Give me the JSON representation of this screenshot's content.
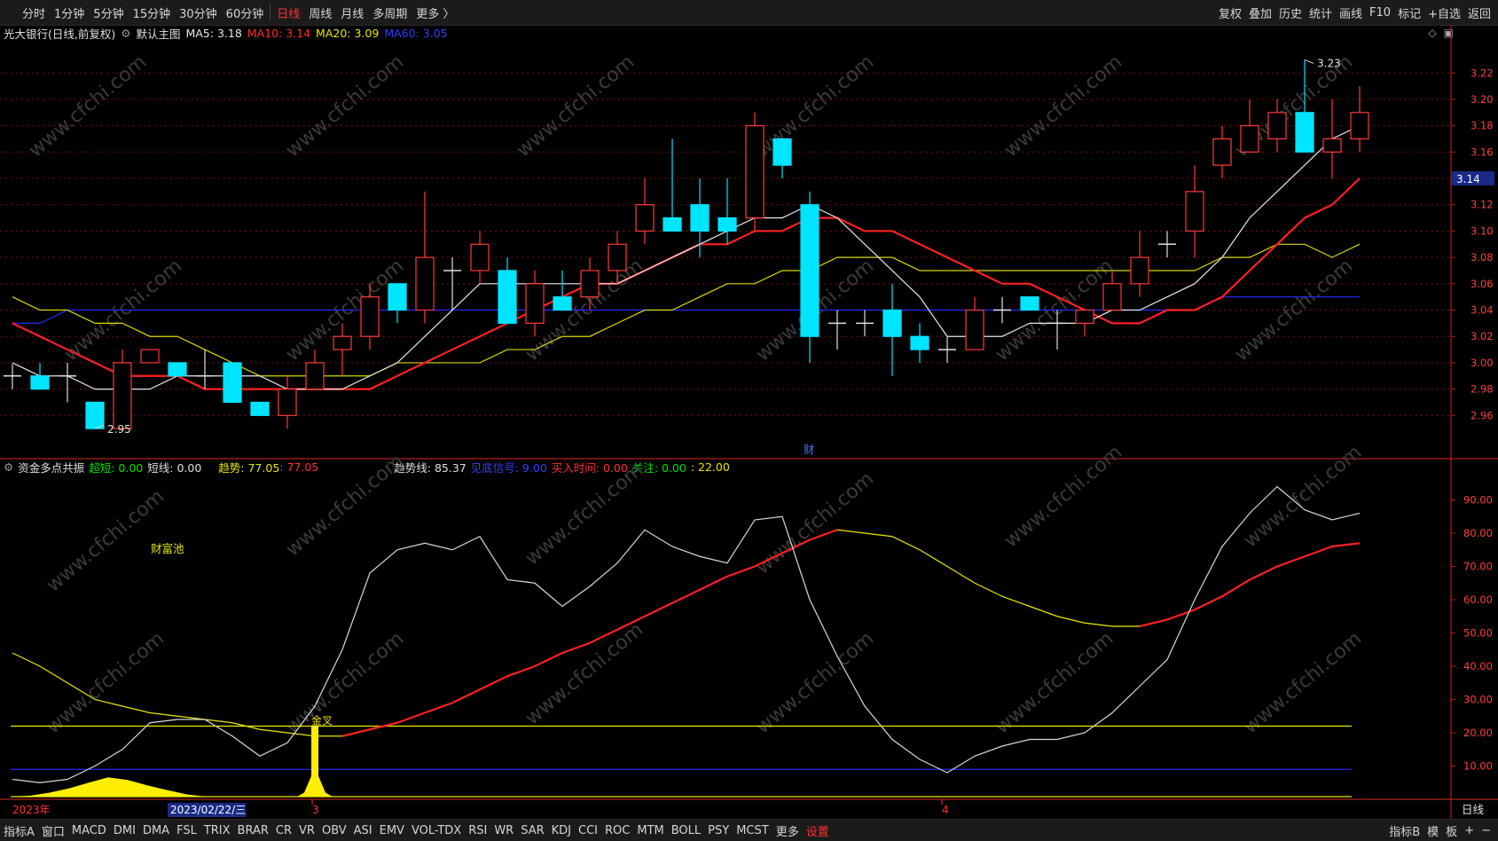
{
  "toolbar": {
    "periods": [
      "分时",
      "1分钟",
      "5分钟",
      "15分钟",
      "30分钟",
      "60分钟",
      "日线",
      "周线",
      "月线",
      "多周期",
      "更多 〉"
    ],
    "active_period": "日线",
    "right_items": [
      "复权",
      "叠加",
      "历史",
      "统计",
      "画线",
      "F10",
      "标记",
      "+自选",
      "返回"
    ]
  },
  "main_chart": {
    "title": "光大银行(日线,前复权)",
    "template": "默认主图",
    "ma5_label": "MA5: 3.18",
    "ma10_label": "MA10: 3.14",
    "ma20_label": "MA20: 3.09",
    "ma60_label": "MA60: 3.05",
    "high_label": "3.23",
    "low_label": "2.95",
    "current_price": "3.14",
    "marker_label": "财",
    "y_ticks": [
      "3.22",
      "3.20",
      "3.18",
      "3.16",
      "3.14",
      "3.12",
      "3.10",
      "3.08",
      "3.06",
      "3.04",
      "3.02",
      "3.00",
      "2.98",
      "2.96"
    ],
    "colors": {
      "up": "#ff3a3a",
      "down": "#00e5ff",
      "ma5": "#e8e8e8",
      "ma10": "#ff2020",
      "ma20": "#d8d800",
      "ma60": "#2828ff"
    }
  },
  "indicator": {
    "name": "资金多点共振",
    "chaoduan": "超短: 0.00",
    "duanxian": "短线: 0.00",
    "qushi": "趋势: 77.05",
    "qushi2": ": 77.05",
    "qushixian": "趋势线: 85.37",
    "dixin": "见底信号: 9.00",
    "mairu": "买入时间: 0.00",
    "guanzhu": "关注: 0.00",
    "extra": ": 22.00",
    "pool_label": "财富池",
    "cross_label": "金叉",
    "y_ticks": [
      "90.00",
      "80.00",
      "70.00",
      "60.00",
      "50.00",
      "40.00",
      "30.00",
      "20.00",
      "10.00"
    ]
  },
  "x_axis": {
    "labels": [
      "2023年",
      "2023/02/22/三",
      "3",
      "4"
    ],
    "right_label": "日线"
  },
  "bottombar": {
    "items": [
      "指标A",
      "窗口",
      "MACD",
      "DMI",
      "DMA",
      "FSL",
      "TRIX",
      "BRAR",
      "CR",
      "VR",
      "OBV",
      "ASI",
      "EMV",
      "VOL-TDX",
      "RSI",
      "WR",
      "SAR",
      "KDJ",
      "CCI",
      "ROC",
      "MTM",
      "BOLL",
      "PSY",
      "MCST",
      "更多",
      "设置"
    ],
    "right_items": [
      "指标B",
      "模",
      "板",
      "+",
      "−"
    ]
  },
  "watermark": "www.cfchi.com",
  "chart_data": {
    "type": "candlestick",
    "candles": [
      {
        "o": 2.99,
        "h": 2.999,
        "l": 2.98,
        "c": 2.99
      },
      {
        "o": 2.99,
        "h": 3.0,
        "l": 2.98,
        "c": 2.98
      },
      {
        "o": 2.99,
        "h": 3.0,
        "l": 2.97,
        "c": 2.99
      },
      {
        "o": 2.97,
        "h": 2.97,
        "l": 2.95,
        "c": 2.95
      },
      {
        "o": 2.95,
        "h": 3.01,
        "l": 2.95,
        "c": 3.0
      },
      {
        "o": 3.0,
        "h": 3.01,
        "l": 3.0,
        "c": 3.01
      },
      {
        "o": 3.0,
        "h": 3.0,
        "l": 2.99,
        "c": 2.99
      },
      {
        "o": 2.99,
        "h": 3.01,
        "l": 2.98,
        "c": 2.99
      },
      {
        "o": 3.0,
        "h": 3.0,
        "l": 2.97,
        "c": 2.97
      },
      {
        "o": 2.97,
        "h": 2.97,
        "l": 2.96,
        "c": 2.96
      },
      {
        "o": 2.96,
        "h": 2.99,
        "l": 2.95,
        "c": 2.98
      },
      {
        "o": 2.98,
        "h": 3.01,
        "l": 2.98,
        "c": 3.0
      },
      {
        "o": 3.01,
        "h": 3.03,
        "l": 2.99,
        "c": 3.02
      },
      {
        "o": 3.02,
        "h": 3.06,
        "l": 3.01,
        "c": 3.05
      },
      {
        "o": 3.06,
        "h": 3.06,
        "l": 3.03,
        "c": 3.04
      },
      {
        "o": 3.04,
        "h": 3.13,
        "l": 3.03,
        "c": 3.08
      },
      {
        "o": 3.07,
        "h": 3.08,
        "l": 3.04,
        "c": 3.07
      },
      {
        "o": 3.07,
        "h": 3.1,
        "l": 3.06,
        "c": 3.09
      },
      {
        "o": 3.07,
        "h": 3.08,
        "l": 3.03,
        "c": 3.03
      },
      {
        "o": 3.03,
        "h": 3.07,
        "l": 3.02,
        "c": 3.06
      },
      {
        "o": 3.05,
        "h": 3.07,
        "l": 3.04,
        "c": 3.04
      },
      {
        "o": 3.05,
        "h": 3.08,
        "l": 3.04,
        "c": 3.07
      },
      {
        "o": 3.07,
        "h": 3.1,
        "l": 3.06,
        "c": 3.09
      },
      {
        "o": 3.1,
        "h": 3.14,
        "l": 3.09,
        "c": 3.12
      },
      {
        "o": 3.11,
        "h": 3.17,
        "l": 3.11,
        "c": 3.1
      },
      {
        "o": 3.12,
        "h": 3.14,
        "l": 3.08,
        "c": 3.1
      },
      {
        "o": 3.11,
        "h": 3.14,
        "l": 3.09,
        "c": 3.1
      },
      {
        "o": 3.11,
        "h": 3.19,
        "l": 3.1,
        "c": 3.18
      },
      {
        "o": 3.17,
        "h": 3.17,
        "l": 3.14,
        "c": 3.15
      },
      {
        "o": 3.12,
        "h": 3.13,
        "l": 3.0,
        "c": 3.02
      },
      {
        "o": 3.03,
        "h": 3.04,
        "l": 3.01,
        "c": 3.03
      },
      {
        "o": 3.03,
        "h": 3.04,
        "l": 3.02,
        "c": 3.03
      },
      {
        "o": 3.04,
        "h": 3.06,
        "l": 2.99,
        "c": 3.02
      },
      {
        "o": 3.02,
        "h": 3.03,
        "l": 3.0,
        "c": 3.01
      },
      {
        "o": 3.01,
        "h": 3.02,
        "l": 3.0,
        "c": 3.01
      },
      {
        "o": 3.01,
        "h": 3.05,
        "l": 3.01,
        "c": 3.04
      },
      {
        "o": 3.04,
        "h": 3.05,
        "l": 3.03,
        "c": 3.04
      },
      {
        "o": 3.05,
        "h": 3.05,
        "l": 3.04,
        "c": 3.04
      },
      {
        "o": 3.03,
        "h": 3.04,
        "l": 3.01,
        "c": 3.03
      },
      {
        "o": 3.03,
        "h": 3.04,
        "l": 3.02,
        "c": 3.04
      },
      {
        "o": 3.04,
        "h": 3.07,
        "l": 3.04,
        "c": 3.06
      },
      {
        "o": 3.06,
        "h": 3.1,
        "l": 3.05,
        "c": 3.08
      },
      {
        "o": 3.09,
        "h": 3.1,
        "l": 3.08,
        "c": 3.09
      },
      {
        "o": 3.1,
        "h": 3.15,
        "l": 3.08,
        "c": 3.13
      },
      {
        "o": 3.15,
        "h": 3.18,
        "l": 3.14,
        "c": 3.17
      },
      {
        "o": 3.16,
        "h": 3.2,
        "l": 3.16,
        "c": 3.18
      },
      {
        "o": 3.17,
        "h": 3.2,
        "l": 3.16,
        "c": 3.19
      },
      {
        "o": 3.19,
        "h": 3.23,
        "l": 3.16,
        "c": 3.16
      },
      {
        "o": 3.16,
        "h": 3.2,
        "l": 3.14,
        "c": 3.17
      },
      {
        "o": 3.17,
        "h": 3.21,
        "l": 3.16,
        "c": 3.19
      }
    ],
    "ma5": [
      3.0,
      2.99,
      2.99,
      2.98,
      2.98,
      2.98,
      2.99,
      2.99,
      2.99,
      2.99,
      2.98,
      2.98,
      2.98,
      2.99,
      3.0,
      3.02,
      3.04,
      3.06,
      3.06,
      3.06,
      3.06,
      3.06,
      3.06,
      3.07,
      3.08,
      3.09,
      3.1,
      3.11,
      3.11,
      3.12,
      3.11,
      3.09,
      3.07,
      3.05,
      3.02,
      3.02,
      3.02,
      3.03,
      3.03,
      3.03,
      3.04,
      3.04,
      3.05,
      3.06,
      3.08,
      3.11,
      3.13,
      3.15,
      3.17,
      3.18
    ],
    "ma10": [
      3.03,
      3.02,
      3.01,
      3.0,
      2.99,
      2.99,
      2.99,
      2.98,
      2.98,
      2.98,
      2.98,
      2.98,
      2.98,
      2.98,
      2.99,
      3.0,
      3.01,
      3.02,
      3.03,
      3.04,
      3.05,
      3.06,
      3.06,
      3.07,
      3.08,
      3.09,
      3.09,
      3.1,
      3.1,
      3.11,
      3.11,
      3.1,
      3.1,
      3.09,
      3.08,
      3.07,
      3.06,
      3.06,
      3.05,
      3.04,
      3.03,
      3.03,
      3.04,
      3.04,
      3.05,
      3.07,
      3.09,
      3.11,
      3.12,
      3.14
    ],
    "ma20": [
      3.05,
      3.04,
      3.04,
      3.03,
      3.03,
      3.02,
      3.02,
      3.01,
      3.0,
      2.99,
      2.99,
      2.99,
      2.99,
      2.99,
      3.0,
      3.0,
      3.0,
      3.0,
      3.01,
      3.01,
      3.02,
      3.02,
      3.03,
      3.04,
      3.04,
      3.05,
      3.06,
      3.06,
      3.07,
      3.07,
      3.08,
      3.08,
      3.08,
      3.07,
      3.07,
      3.07,
      3.07,
      3.07,
      3.07,
      3.07,
      3.07,
      3.07,
      3.07,
      3.07,
      3.08,
      3.08,
      3.09,
      3.09,
      3.08,
      3.09
    ],
    "ma60": [
      3.03,
      3.03,
      3.04,
      3.04,
      3.04,
      3.04,
      3.04,
      3.04,
      3.04,
      3.04,
      3.04,
      3.04,
      3.04,
      3.04,
      3.04,
      3.04,
      3.04,
      3.04,
      3.04,
      3.04,
      3.04,
      3.04,
      3.04,
      3.04,
      3.04,
      3.04,
      3.04,
      3.04,
      3.04,
      3.04,
      3.04,
      3.04,
      3.04,
      3.04,
      3.04,
      3.04,
      3.04,
      3.04,
      3.04,
      3.04,
      3.04,
      3.04,
      3.04,
      3.04,
      3.05,
      3.05,
      3.05,
      3.05,
      3.05,
      3.05
    ],
    "trend_line": [
      6,
      5,
      6,
      10,
      15,
      23,
      24,
      24,
      19,
      13,
      17,
      28,
      45,
      68,
      75,
      77,
      75,
      79,
      66,
      65,
      58,
      64,
      71,
      81,
      76,
      73,
      71,
      84,
      85,
      60,
      43,
      28,
      18,
      12,
      8,
      13,
      16,
      18,
      18,
      20,
      26,
      34,
      42,
      60,
      76,
      86,
      94,
      87,
      84,
      86
    ],
    "trend": [
      44,
      40,
      35,
      30,
      28,
      26,
      25,
      24,
      23,
      21,
      20,
      19,
      19,
      21,
      23,
      26,
      29,
      33,
      37,
      40,
      44,
      47,
      51,
      55,
      59,
      63,
      67,
      70,
      74,
      78,
      81,
      80,
      79,
      75,
      70,
      65,
      61,
      58,
      55,
      53,
      52,
      52,
      54,
      57,
      61,
      66,
      70,
      73,
      76,
      77
    ],
    "ref_lines": [
      22,
      9,
      0
    ],
    "ylim": [
      0,
      100
    ],
    "price_ylim": [
      2.94,
      3.235
    ]
  }
}
